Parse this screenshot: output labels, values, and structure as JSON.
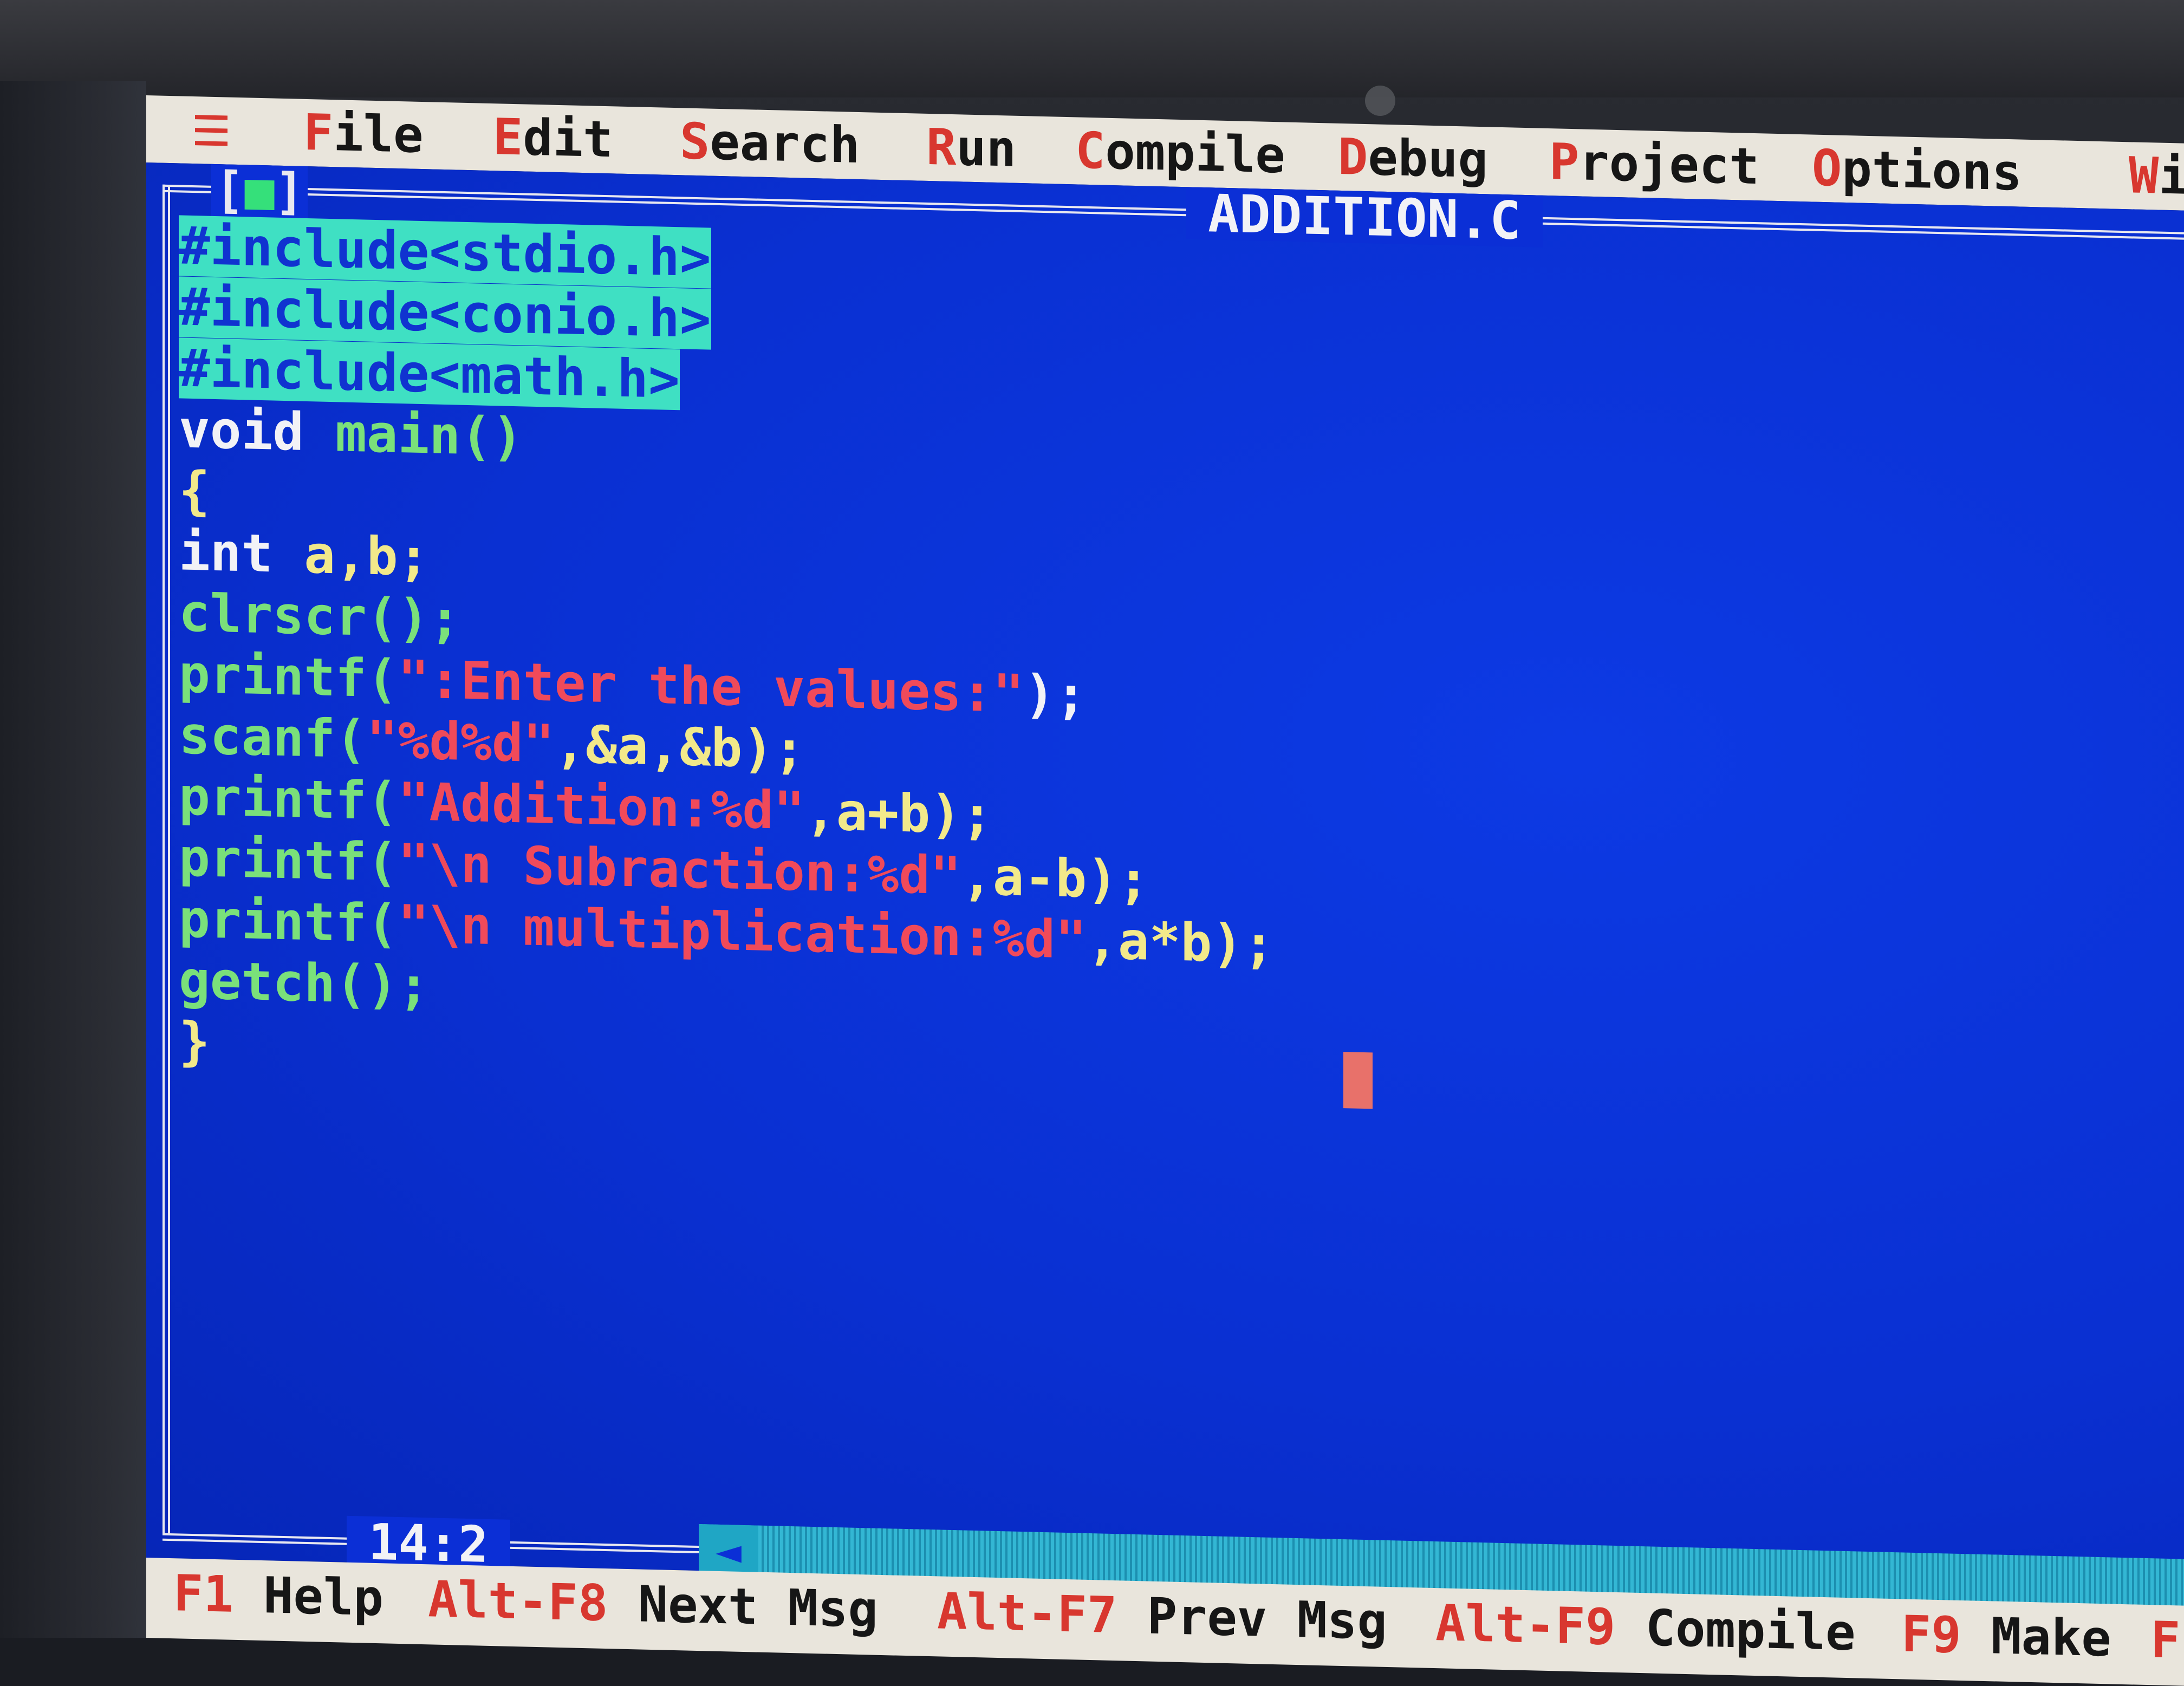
{
  "menu": {
    "system_icon": "hamburger-menu-icon",
    "items": [
      {
        "hot": "F",
        "rest": "ile"
      },
      {
        "hot": "E",
        "rest": "dit"
      },
      {
        "hot": "S",
        "rest": "earch"
      },
      {
        "hot": "R",
        "rest": "un"
      },
      {
        "hot": "C",
        "rest": "ompile"
      },
      {
        "hot": "D",
        "rest": "ebug"
      },
      {
        "hot": "P",
        "rest": "roject"
      },
      {
        "hot": "O",
        "rest": "ptions"
      },
      {
        "hot": "W",
        "rest": "i"
      }
    ]
  },
  "window": {
    "close_box_left": "[",
    "close_box_mark": "■",
    "close_box_right": "]",
    "filename": "ADDITION.C",
    "cursor_position": "14:2"
  },
  "code": [
    [
      {
        "t": "#include<stdio.h>",
        "c": "sel"
      }
    ],
    [
      {
        "t": "#include<conio.h>",
        "c": "sel"
      }
    ],
    [
      {
        "t": "#include<math.h>",
        "c": "sel"
      }
    ],
    [
      {
        "t": "void ",
        "c": "kw"
      },
      {
        "t": "main()",
        "c": "fn"
      }
    ],
    [
      {
        "t": "{",
        "c": "ident"
      }
    ],
    [
      {
        "t": "int ",
        "c": "kw"
      },
      {
        "t": "a,b;",
        "c": "ident"
      }
    ],
    [
      {
        "t": "clrscr();",
        "c": "fn"
      }
    ],
    [
      {
        "t": "printf(",
        "c": "fn"
      },
      {
        "t": "\":Enter the values:\"",
        "c": "str"
      },
      {
        "t": ");",
        "c": "punct"
      }
    ],
    [
      {
        "t": "scanf(",
        "c": "fn"
      },
      {
        "t": "\"%d%d\"",
        "c": "str"
      },
      {
        "t": ",&a,&b);",
        "c": "ident"
      }
    ],
    [
      {
        "t": "printf(",
        "c": "fn"
      },
      {
        "t": "\"Addition:%d\"",
        "c": "str"
      },
      {
        "t": ",a+b);",
        "c": "ident"
      }
    ],
    [
      {
        "t": "printf(",
        "c": "fn"
      },
      {
        "t": "\"\\n Subraction:%d\"",
        "c": "str"
      },
      {
        "t": ",a-b);",
        "c": "ident"
      }
    ],
    [
      {
        "t": "printf(",
        "c": "fn"
      },
      {
        "t": "\"\\n multiplication:%d\"",
        "c": "str"
      },
      {
        "t": ",a*b);",
        "c": "ident"
      }
    ],
    [
      {
        "t": "getch();",
        "c": "fn"
      }
    ],
    [
      {
        "t": "}",
        "c": "ident"
      }
    ]
  ],
  "scroll": {
    "left_arrow_icon": "scroll-left-arrow-icon",
    "glyph": "◄"
  },
  "hints": [
    {
      "key": "F1",
      "label": "Help"
    },
    {
      "key": "Alt-F8",
      "label": "Next Msg"
    },
    {
      "key": "Alt-F7",
      "label": "Prev Msg"
    },
    {
      "key": "Alt-F9",
      "label": "Compile"
    },
    {
      "key": "F9",
      "label": "Make"
    },
    {
      "key": "F",
      "label": ""
    }
  ],
  "colors": {
    "editor_bg": "#0b2fd6",
    "menu_bg": "#e9e5dc",
    "hotkey": "#d8372f",
    "selection": "#3fe0c3",
    "string": "#f04a5a",
    "function": "#7ae07a",
    "identifier": "#f2e98a",
    "cursor": "#e8716a"
  }
}
